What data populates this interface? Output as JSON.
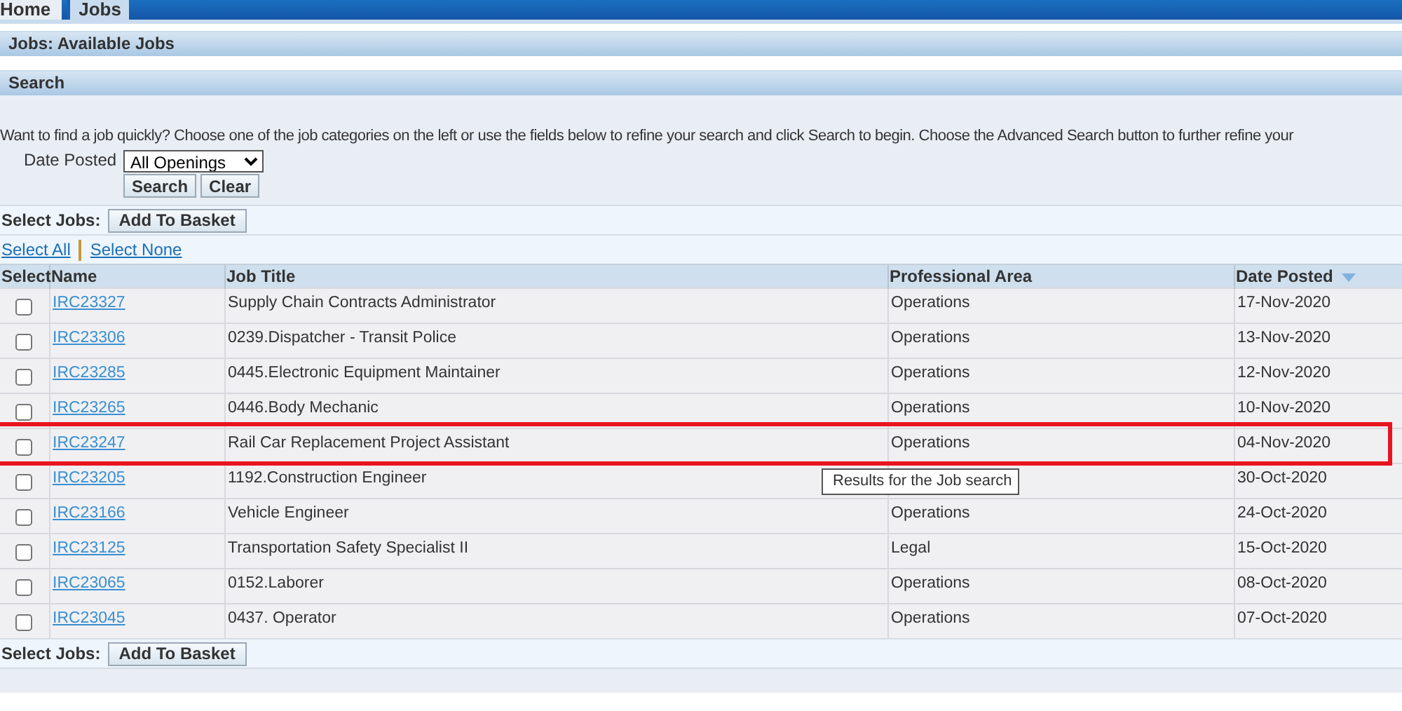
{
  "tabs": [
    {
      "label": "Home",
      "selected": false
    },
    {
      "label": "Jobs",
      "selected": true
    }
  ],
  "page_header": "Jobs: Available Jobs",
  "search": {
    "header": "Search",
    "instructions": "Want to find a job quickly? Choose one of the job categories on the left or use the fields below to refine your search and click Search to begin. Choose the Advanced Search button to further refine your",
    "date_posted_label": "Date Posted",
    "date_posted_value": "All Openings",
    "buttons": [
      "Search",
      "Clear"
    ]
  },
  "select_jobs_top": {
    "label": "Select Jobs:",
    "button": "Add To Basket"
  },
  "select_links": [
    "Select All",
    "Select None"
  ],
  "table": {
    "columns": [
      {
        "label": "Select",
        "sorted": false
      },
      {
        "label": "Name",
        "sorted": false
      },
      {
        "label": "Job Title",
        "sorted": false
      },
      {
        "label": "Professional Area",
        "sorted": false
      },
      {
        "label": "Date Posted",
        "sorted": true
      }
    ],
    "rows": [
      {
        "checked": false,
        "name": "IRC23327",
        "title": "Supply Chain Contracts Administrator",
        "area": "Operations",
        "date": "17-Nov-2020"
      },
      {
        "checked": false,
        "name": "IRC23306",
        "title": "0239.Dispatcher - Transit Police",
        "area": "Operations",
        "date": "13-Nov-2020"
      },
      {
        "checked": false,
        "name": "IRC23285",
        "title": "0445.Electronic Equipment Maintainer",
        "area": "Operations",
        "date": "12-Nov-2020"
      },
      {
        "checked": false,
        "name": "IRC23265",
        "title": "0446.Body Mechanic",
        "area": "Operations",
        "date": "10-Nov-2020"
      },
      {
        "checked": false,
        "name": "IRC23247",
        "title": "Rail Car Replacement Project Assistant",
        "area": "Operations",
        "date": "04-Nov-2020",
        "highlighted": true
      },
      {
        "checked": false,
        "name": "IRC23205",
        "title": "1192.Construction Engineer",
        "date": "30-Oct-2020"
      },
      {
        "checked": false,
        "name": "IRC23166",
        "title": "Vehicle Engineer",
        "area": "Operations",
        "date": "24-Oct-2020"
      },
      {
        "checked": false,
        "name": "IRC23125",
        "title": "Transportation Safety Specialist II",
        "area": "Legal",
        "date": "15-Oct-2020"
      },
      {
        "checked": false,
        "name": "IRC23065",
        "title": "0152.Laborer",
        "area": "Operations",
        "date": "08-Oct-2020"
      },
      {
        "checked": false,
        "name": "IRC23045",
        "title": "0437. Operator",
        "area": "Operations",
        "date": "07-Oct-2020"
      }
    ]
  },
  "tooltip": "Results for the Job search",
  "select_jobs_bottom": {
    "label": "Select Jobs:",
    "button": "Add To Basket"
  }
}
